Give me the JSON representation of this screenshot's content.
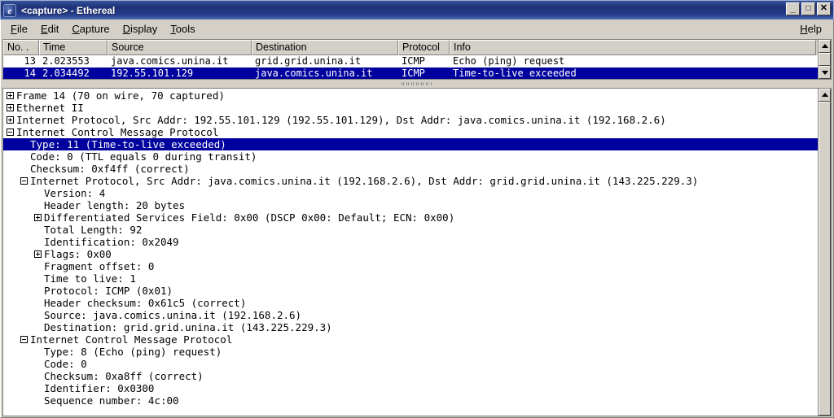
{
  "window": {
    "title": "<capture> - Ethereal",
    "icon": "ethereal-e-icon",
    "minimize_label": "_",
    "maximize_label": "□",
    "close_label": "✕"
  },
  "menubar": {
    "items": [
      {
        "label": "File",
        "mnemonic": "F"
      },
      {
        "label": "Edit",
        "mnemonic": "E"
      },
      {
        "label": "Capture",
        "mnemonic": "C"
      },
      {
        "label": "Display",
        "mnemonic": "D"
      },
      {
        "label": "Tools",
        "mnemonic": "T"
      }
    ],
    "help": {
      "label": "Help",
      "mnemonic": "H"
    }
  },
  "packet_list": {
    "columns": [
      "No. .",
      "Time",
      "Source",
      "Destination",
      "Protocol",
      "Info"
    ],
    "rows": [
      {
        "no": "13",
        "time": "2.023553",
        "source": "java.comics.unina.it",
        "destination": "grid.grid.unina.it",
        "protocol": "ICMP",
        "info": "Echo (ping) request",
        "selected": false
      },
      {
        "no": "14",
        "time": "2.034492",
        "source": "192.55.101.129",
        "destination": "java.comics.unina.it",
        "protocol": "ICMP",
        "info": "Time-to-live exceeded",
        "selected": true
      }
    ]
  },
  "detail_tree": {
    "lines": [
      {
        "indent": 0,
        "twist": "plus",
        "text": "Frame 14 (70 on wire, 70 captured)",
        "selected": false
      },
      {
        "indent": 0,
        "twist": "plus",
        "text": "Ethernet II",
        "selected": false
      },
      {
        "indent": 0,
        "twist": "plus",
        "text": "Internet Protocol, Src Addr: 192.55.101.129 (192.55.101.129), Dst Addr: java.comics.unina.it (192.168.2.6)",
        "selected": false
      },
      {
        "indent": 0,
        "twist": "minus",
        "text": "Internet Control Message Protocol",
        "selected": false
      },
      {
        "indent": 1,
        "twist": "none",
        "text": "Type: 11 (Time-to-live exceeded)",
        "selected": true
      },
      {
        "indent": 1,
        "twist": "none",
        "text": "Code: 0 (TTL equals 0 during transit)",
        "selected": false
      },
      {
        "indent": 1,
        "twist": "none",
        "text": "Checksum: 0xf4ff (correct)",
        "selected": false
      },
      {
        "indent": 1,
        "twist": "minus",
        "text": "Internet Protocol, Src Addr: java.comics.unina.it (192.168.2.6), Dst Addr: grid.grid.unina.it (143.225.229.3)",
        "selected": false
      },
      {
        "indent": 2,
        "twist": "none",
        "text": "Version: 4",
        "selected": false
      },
      {
        "indent": 2,
        "twist": "none",
        "text": "Header length: 20 bytes",
        "selected": false
      },
      {
        "indent": 2,
        "twist": "plus",
        "text": "Differentiated Services Field: 0x00 (DSCP 0x00: Default; ECN: 0x00)",
        "selected": false
      },
      {
        "indent": 2,
        "twist": "none",
        "text": "Total Length: 92",
        "selected": false
      },
      {
        "indent": 2,
        "twist": "none",
        "text": "Identification: 0x2049",
        "selected": false
      },
      {
        "indent": 2,
        "twist": "plus",
        "text": "Flags: 0x00",
        "selected": false
      },
      {
        "indent": 2,
        "twist": "none",
        "text": "Fragment offset: 0",
        "selected": false
      },
      {
        "indent": 2,
        "twist": "none",
        "text": "Time to live: 1",
        "selected": false
      },
      {
        "indent": 2,
        "twist": "none",
        "text": "Protocol: ICMP (0x01)",
        "selected": false
      },
      {
        "indent": 2,
        "twist": "none",
        "text": "Header checksum: 0x61c5 (correct)",
        "selected": false
      },
      {
        "indent": 2,
        "twist": "none",
        "text": "Source: java.comics.unina.it (192.168.2.6)",
        "selected": false
      },
      {
        "indent": 2,
        "twist": "none",
        "text": "Destination: grid.grid.unina.it (143.225.229.3)",
        "selected": false
      },
      {
        "indent": 1,
        "twist": "minus",
        "text": "Internet Control Message Protocol",
        "selected": false
      },
      {
        "indent": 2,
        "twist": "none",
        "text": "Type: 8 (Echo (ping) request)",
        "selected": false
      },
      {
        "indent": 2,
        "twist": "none",
        "text": "Code: 0",
        "selected": false
      },
      {
        "indent": 2,
        "twist": "none",
        "text": "Checksum: 0xa8ff (correct)",
        "selected": false
      },
      {
        "indent": 2,
        "twist": "none",
        "text": "Identifier: 0x0300",
        "selected": false
      },
      {
        "indent": 2,
        "twist": "none",
        "text": "Sequence number: 4c:00",
        "selected": false
      }
    ]
  },
  "colors": {
    "selection": "#00009e",
    "window_face": "#d4d0c8",
    "titlebar_active": "#1d3278"
  }
}
